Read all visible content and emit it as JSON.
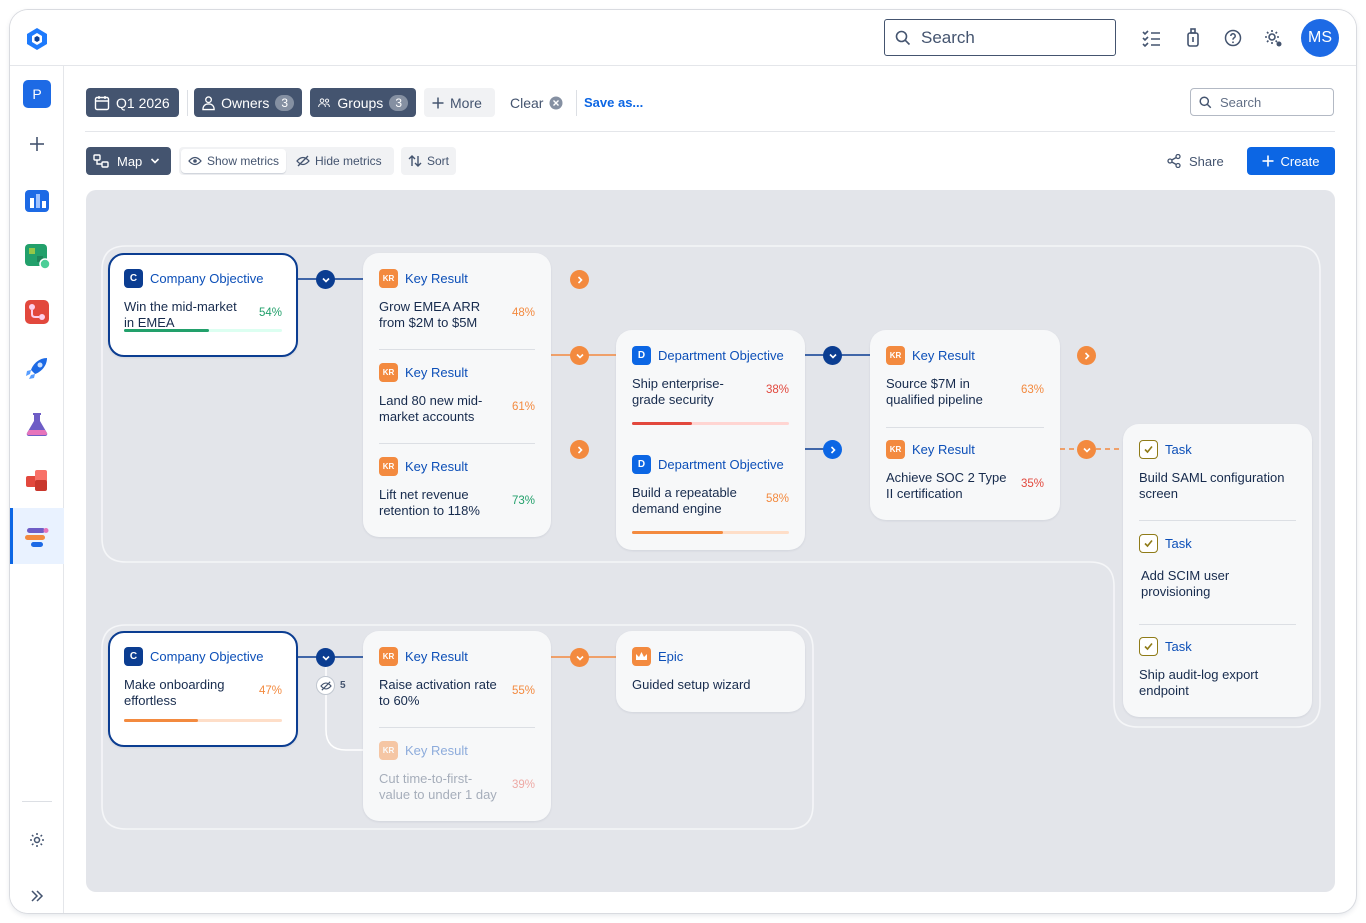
{
  "topbar": {
    "search_placeholder": "Search",
    "avatar_initials": "MS",
    "icons": [
      "logo-icon",
      "checklist-icon",
      "notification-icon",
      "help-icon",
      "settings-icon"
    ]
  },
  "rail": {
    "space_initial": "P",
    "items": [
      "plus-icon",
      "analytics-app-icon",
      "spreadsheet-app-icon",
      "source-control-app-icon",
      "rocket-app-icon",
      "lab-flask-app-icon",
      "cubes-app-icon",
      "goals-app-icon"
    ],
    "bottom": [
      "settings-icon",
      "expand-icon"
    ]
  },
  "filters": {
    "quarter": "Q1 2026",
    "owners": {
      "label": "Owners",
      "count": "3"
    },
    "groups": {
      "label": "Groups",
      "count": "3"
    },
    "more": "More",
    "clear": "Clear",
    "save_as": "Save as...",
    "search_placeholder": "Search"
  },
  "viewbar": {
    "view": "Map",
    "show_metrics": "Show metrics",
    "hide_metrics": "Hide metrics",
    "sort": "Sort",
    "share": "Share",
    "create": "Create"
  },
  "colors": {
    "navy": "#0b3d91",
    "blue": "#0c66e4",
    "orange": "#f38a3f",
    "green": "#22a06b",
    "red": "#e2483d"
  },
  "map": {
    "obj1": {
      "type": "Company Objective",
      "badge": "C",
      "title": "Win the mid-market\nin EMEA",
      "pct": "54%",
      "progress": 0.54
    },
    "kr1": [
      {
        "type": "Key Result",
        "badge": "KR",
        "title": "Grow EMEA ARR\nfrom $2M to $5M",
        "pct": "48%"
      },
      {
        "type": "Key Result",
        "badge": "KR",
        "title": "Land 80 new mid-\nmarket accounts",
        "pct": "61%"
      },
      {
        "type": "Key Result",
        "badge": "KR",
        "title": "Lift net revenue\nretention to 118%",
        "pct": "73%"
      }
    ],
    "dept": [
      {
        "type": "Department Objective",
        "badge": "D",
        "title": "Ship enterprise-\ngrade security",
        "pct": "38%",
        "progress": 0.38
      },
      {
        "type": "Department Objective",
        "badge": "D",
        "title": "Build a repeatable\ndemand engine",
        "pct": "58%",
        "progress": 0.58
      }
    ],
    "kr2": [
      {
        "type": "Key Result",
        "badge": "KR",
        "title": "Source $7M in\nqualified pipeline",
        "pct": "63%"
      },
      {
        "type": "Key Result",
        "badge": "KR",
        "title": "Achieve SOC 2 Type\nII certification",
        "pct": "35%"
      }
    ],
    "tasks": [
      {
        "type": "Task",
        "title": "Build SAML configuration\nscreen"
      },
      {
        "type": "Task",
        "title": "Add SCIM user\nprovisioning"
      },
      {
        "type": "Task",
        "title": "Ship audit-log export\nendpoint"
      }
    ],
    "obj2": {
      "type": "Company Objective",
      "badge": "C",
      "title": "Make onboarding\neffortless",
      "pct": "47%",
      "progress": 0.47
    },
    "hidden_count": "5",
    "kr3": [
      {
        "type": "Key Result",
        "badge": "KR",
        "title": "Raise activation rate\nto 60%",
        "pct": "55%"
      },
      {
        "type": "Key Result",
        "badge": "KR",
        "title": "Cut time-to-first-\nvalue to under 1 day",
        "pct": "39%"
      }
    ],
    "epic": {
      "type": "Epic",
      "title": "Guided setup wizard"
    }
  }
}
